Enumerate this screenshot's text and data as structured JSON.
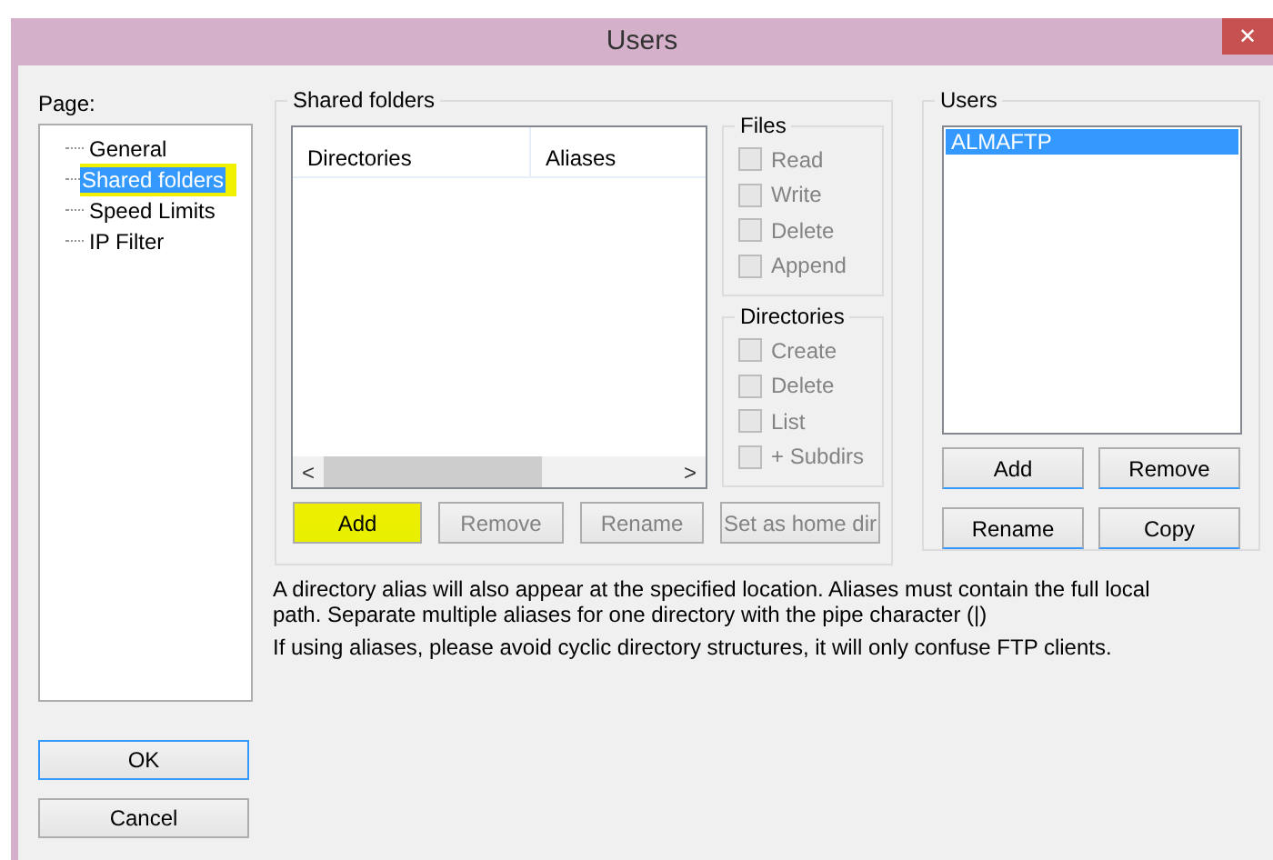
{
  "window": {
    "title": "Users",
    "close_glyph": "✕"
  },
  "page_label": "Page:",
  "tree": [
    {
      "label": "General",
      "selected": false,
      "highlighted": false
    },
    {
      "label": "Shared folders",
      "selected": true,
      "highlighted": true
    },
    {
      "label": "Speed Limits",
      "selected": false,
      "highlighted": false
    },
    {
      "label": "IP Filter",
      "selected": false,
      "highlighted": false
    }
  ],
  "shared_folders": {
    "title": "Shared folders",
    "columns": [
      "Directories",
      "Aliases"
    ],
    "scroll_left": "<",
    "scroll_right": ">",
    "files": {
      "title": "Files",
      "options": [
        {
          "label": "Read",
          "checked": false,
          "disabled": true
        },
        {
          "label": "Write",
          "checked": false,
          "disabled": true
        },
        {
          "label": "Delete",
          "checked": false,
          "disabled": true
        },
        {
          "label": "Append",
          "checked": false,
          "disabled": true
        }
      ]
    },
    "directories": {
      "title": "Directories",
      "options": [
        {
          "label": "Create",
          "checked": false,
          "disabled": true
        },
        {
          "label": "Delete",
          "checked": false,
          "disabled": true
        },
        {
          "label": "List",
          "checked": false,
          "disabled": true
        },
        {
          "label": "+ Subdirs",
          "checked": false,
          "disabled": true
        }
      ]
    },
    "buttons": [
      {
        "label": "Add",
        "disabled": false,
        "highlighted": true
      },
      {
        "label": "Remove",
        "disabled": true,
        "highlighted": false
      },
      {
        "label": "Rename",
        "disabled": true,
        "highlighted": false
      },
      {
        "label": "Set as home dir",
        "disabled": true,
        "highlighted": false
      }
    ]
  },
  "users": {
    "title": "Users",
    "items": [
      {
        "label": "ALMAFTP",
        "selected": true
      }
    ],
    "buttons": [
      {
        "label": "Add"
      },
      {
        "label": "Remove"
      },
      {
        "label": "Rename"
      },
      {
        "label": "Copy"
      }
    ]
  },
  "notes": [
    "A directory alias will also appear at the specified location. Aliases must contain the full local path. Separate multiple aliases for one directory with the pipe character (|)",
    "If using aliases, please avoid cyclic directory structures, it will only confuse FTP clients."
  ],
  "buttons": [
    {
      "label": "OK",
      "default": true
    },
    {
      "label": "Cancel",
      "default": false
    }
  ]
}
